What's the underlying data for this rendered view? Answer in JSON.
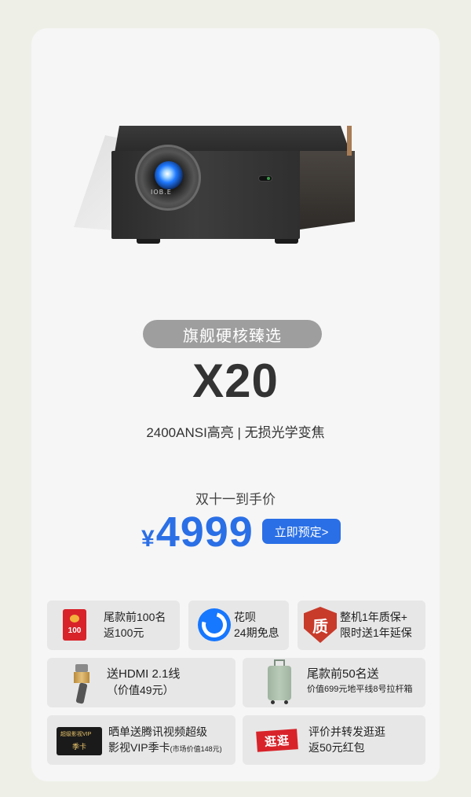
{
  "product": {
    "tagline": "旗舰硬核臻选",
    "model": "X20",
    "specs": "2400ANSI高亮 | 无损光学变焦",
    "brand_mark": "IOB.E"
  },
  "pricing": {
    "label": "双十一到手价",
    "currency": "¥",
    "price": "4999",
    "cta": "立即预定>"
  },
  "perks": {
    "red_packet_amount": "100",
    "p1_line1": "尾款前100名",
    "p1_line2": "返100元",
    "p2_line1": "花呗",
    "p2_line2": "24期免息",
    "p3_icon": "质",
    "p3_line1": "整机1年质保+",
    "p3_line2": "限时送1年延保",
    "p4_line1": "送HDMI 2.1线",
    "p4_line2": "（价值49元）",
    "p5_line1": "尾款前50名送",
    "p5_line2": "价值699元地平线8号拉杆箱",
    "p6_vip_line1": "超级影视VIP",
    "p6_vip_line2": "季卡",
    "p6_line1": "晒单送腾讯视频超级",
    "p6_line2": "影视VIP季卡",
    "p6_note": "(市场价值148元)",
    "p7_icon": "逛逛",
    "p7_line1": "评价并转发逛逛",
    "p7_line2": "返50元红包"
  },
  "colors": {
    "accent": "#2a6fe6",
    "pill": "#9e9e9e",
    "red": "#d8232a"
  }
}
